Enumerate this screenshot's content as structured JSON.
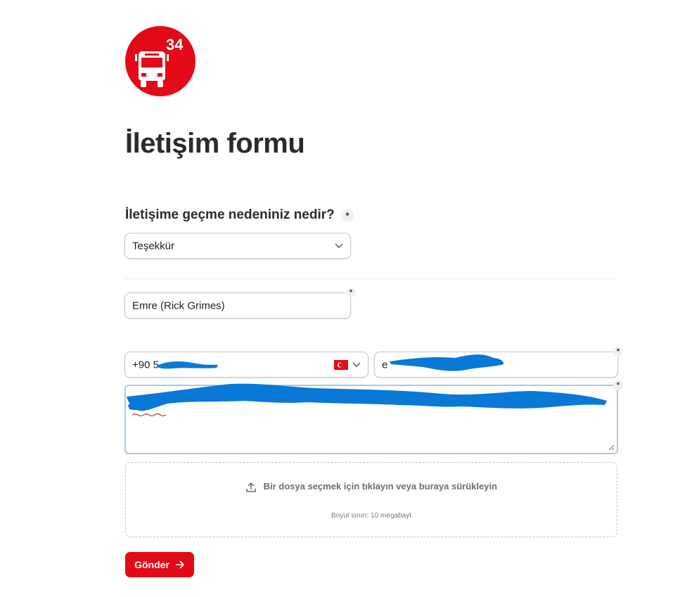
{
  "logo": {
    "number": "34",
    "icon": "bus-icon"
  },
  "page_title": "İletişim formu",
  "reason": {
    "question": "İletişime geçme nedeniniz nedir?",
    "required_mark": "*",
    "selected": "Teşekkür"
  },
  "name_field": {
    "value": "Emre (Rick Grimes)",
    "required_mark": "*"
  },
  "phone_field": {
    "value": "+90 5",
    "country_flag": "TR"
  },
  "email_field": {
    "value": "e",
    "required_mark": "*"
  },
  "message_field": {
    "required_mark": "*"
  },
  "upload": {
    "prompt": "Bir dosya seçmek için tıklayın veya buraya sürükleyin",
    "size_limit": "Boyut sınırı: 10 megabayt"
  },
  "submit": {
    "label": "Gönder"
  },
  "colors": {
    "brand_red": "#e30a17",
    "scribble_blue": "#0a78d7"
  }
}
